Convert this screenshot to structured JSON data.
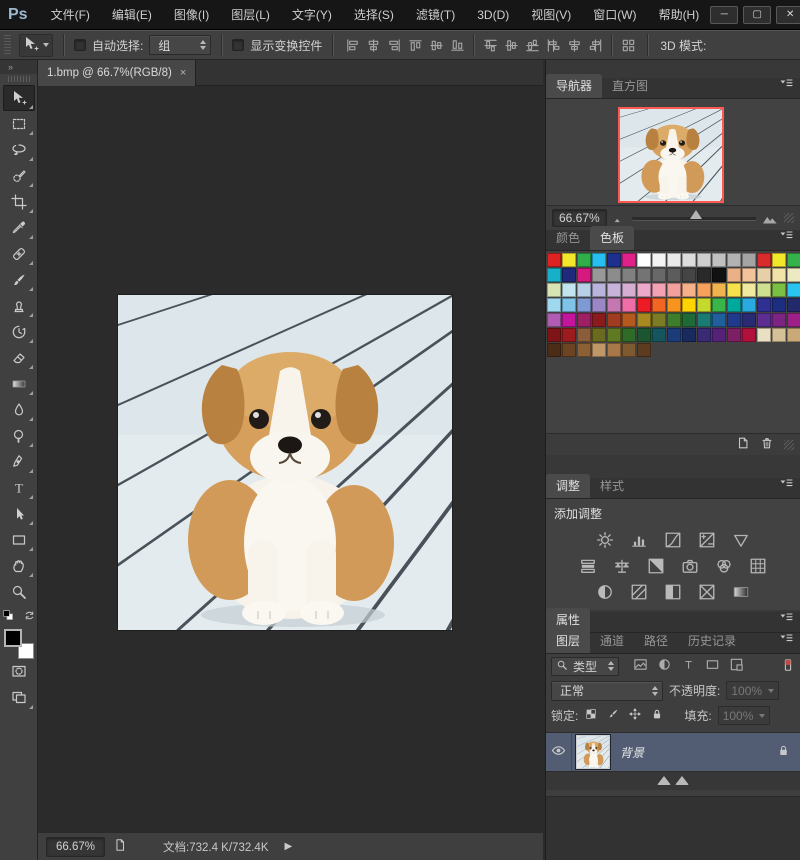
{
  "window": {
    "logo": "Ps",
    "controls": {
      "minimize": "─",
      "maximize": "▢",
      "close": "✕"
    }
  },
  "menu_bar": {
    "items": [
      "文件(F)",
      "编辑(E)",
      "图像(I)",
      "图层(L)",
      "文字(Y)",
      "选择(S)",
      "滤镜(T)",
      "3D(D)",
      "视图(V)",
      "窗口(W)",
      "帮助(H)"
    ]
  },
  "options_bar": {
    "active_tool_icon": "move-tool",
    "auto_select_label": "自动选择:",
    "auto_select_value": "组",
    "show_transform_label": "显示变换控件",
    "mode_3d_label": "3D 模式:",
    "align_groups": [
      [
        "align-left",
        "align-h-center",
        "align-right"
      ],
      [
        "align-top",
        "align-v-center",
        "align-bottom"
      ],
      [
        "dist-top",
        "dist-v-center",
        "dist-bottom"
      ],
      [
        "dist-left",
        "dist-h-center",
        "dist-right"
      ],
      [
        "auto-align"
      ]
    ]
  },
  "document_tab": {
    "title": "1.bmp @ 66.7%(RGB/8)",
    "close": "×"
  },
  "toolbar": {
    "collapse_chevrons": "»",
    "tools": [
      {
        "name": "move-tool",
        "selected": true,
        "flyout": true
      },
      {
        "name": "marquee-tool",
        "selected": false,
        "flyout": true
      },
      {
        "name": "lasso-tool",
        "selected": false,
        "flyout": true
      },
      {
        "name": "quick-select-tool",
        "selected": false,
        "flyout": true
      },
      {
        "name": "crop-tool",
        "selected": false,
        "flyout": true
      },
      {
        "name": "eyedropper-tool",
        "selected": false,
        "flyout": true
      },
      {
        "name": "healing-brush-tool",
        "selected": false,
        "flyout": true
      },
      {
        "name": "brush-tool",
        "selected": false,
        "flyout": true
      },
      {
        "name": "clone-stamp-tool",
        "selected": false,
        "flyout": true
      },
      {
        "name": "history-brush-tool",
        "selected": false,
        "flyout": true
      },
      {
        "name": "eraser-tool",
        "selected": false,
        "flyout": true
      },
      {
        "name": "gradient-tool",
        "selected": false,
        "flyout": true
      },
      {
        "name": "blur-tool",
        "selected": false,
        "flyout": true
      },
      {
        "name": "dodge-tool",
        "selected": false,
        "flyout": true
      },
      {
        "name": "pen-tool",
        "selected": false,
        "flyout": true
      },
      {
        "name": "type-tool",
        "selected": false,
        "flyout": true
      },
      {
        "name": "path-select-tool",
        "selected": false,
        "flyout": true
      },
      {
        "name": "rectangle-tool",
        "selected": false,
        "flyout": true
      },
      {
        "name": "hand-tool",
        "selected": false,
        "flyout": true
      },
      {
        "name": "zoom-tool",
        "selected": false,
        "flyout": false
      }
    ]
  },
  "panels": {
    "navigator": {
      "tabs": [
        {
          "label": "导航器",
          "active": true
        },
        {
          "label": "直方图",
          "active": false
        }
      ],
      "zoom": "66.67%"
    },
    "color": {
      "tabs": [
        {
          "label": "颜色",
          "active": false
        },
        {
          "label": "色板",
          "active": true
        }
      ],
      "swatch_rows": [
        [
          "#dd2222",
          "#f3e72c",
          "#2fae49",
          "#27bef0",
          "#1f2f8f",
          "#e0218a",
          "#ffffff",
          "#f4f4f4",
          "#e9e9e9",
          "#dcdcdc",
          "#cecece",
          "#c0c0c0",
          "#b2b2b2",
          "#a4a4a4",
          "#d92b2b",
          "#f3e72c",
          "#35b34a"
        ],
        [
          "#18b0c8",
          "#202a7c",
          "#d6197f",
          "#989898",
          "#8c8c8c",
          "#808080",
          "#747474",
          "#686868",
          "#5c5c5c",
          "#454545",
          "#2a2a2a",
          "#111111",
          "#eab188",
          "#f2c29a",
          "#e7cfa8",
          "#f2e3a8",
          "#ede9c2"
        ],
        [
          "#d9e4b5",
          "#c2e4ee",
          "#b8cfe8",
          "#b9b4dc",
          "#c7b3d9",
          "#d5aed1",
          "#eba8c8",
          "#f2a2b4",
          "#f2a09b",
          "#f5b18a",
          "#f6a25c",
          "#f0b44e",
          "#f5e14c",
          "#f0ea9e",
          "#cfe08e",
          "#7ac143",
          "#29c5f0"
        ],
        [
          "#9fd8ef",
          "#7fc3e8",
          "#7f9ad3",
          "#9b86c6",
          "#c577b2",
          "#ef6ea8",
          "#ed1c24",
          "#f26522",
          "#f7941d",
          "#ffd400",
          "#c5d92d",
          "#39b54a",
          "#00a99d",
          "#29abe2",
          "#2e3192",
          "#1c2e82",
          "#232a6b"
        ],
        [
          "#b05cb0",
          "#c4169c",
          "#9e1f63",
          "#8b1a1a",
          "#a23c20",
          "#b55a1f",
          "#a8891f",
          "#7c7c24",
          "#3e7d2c",
          "#1f6b38",
          "#1b7a74",
          "#1f5f9e",
          "#20398c",
          "#292a74",
          "#5d2d91",
          "#7b2482",
          "#9e1f87"
        ],
        [
          "#7e1416",
          "#9b1b1e",
          "#8a5d3b",
          "#6b6b1f",
          "#5f7a23",
          "#2e6b28",
          "#1c5631",
          "#15565e",
          "#1b3c78",
          "#182a5e",
          "#3a2a74",
          "#552277",
          "#7c1f63",
          "#b0103a",
          "#eadfc2",
          "#d6c097",
          "#c9a978"
        ],
        [
          "#4a2c17",
          "#6b4423",
          "#8a6034",
          "#c09868",
          "#a87848",
          "#7e5a30",
          "#5c3c1e"
        ]
      ]
    },
    "adjustments": {
      "tabs": [
        {
          "label": "调整",
          "active": true
        },
        {
          "label": "样式",
          "active": false
        }
      ],
      "add_label": "添加调整",
      "icon_rows": [
        [
          "brightness-contrast",
          "levels",
          "curves",
          "exposure",
          "vibrance"
        ],
        [
          "hue-saturation",
          "color-balance",
          "black-white",
          "photo-filter",
          "channel-mixer",
          "color-lookup"
        ],
        [
          "invert",
          "posterize",
          "threshold",
          "selective-color",
          "gradient-map"
        ]
      ]
    },
    "properties": {
      "tabs": [
        {
          "label": "属性",
          "active": true
        }
      ]
    },
    "layers": {
      "tabs": [
        {
          "label": "图层",
          "active": true
        },
        {
          "label": "通道",
          "active": false
        },
        {
          "label": "路径",
          "active": false
        },
        {
          "label": "历史记录",
          "active": false
        }
      ],
      "filter_type_label": "类型",
      "filter_icons": [
        "pixel-filter",
        "adjustment-filter",
        "type-filter",
        "shape-filter",
        "smartobject-filter"
      ],
      "blend_mode": "正常",
      "opacity_label": "不透明度:",
      "opacity_value": "100%",
      "lock_label": "锁定:",
      "lock_icons": [
        "lock-transparency",
        "lock-pixels",
        "lock-position",
        "lock-all"
      ],
      "fill_label": "填充:",
      "fill_value": "100%",
      "layer": {
        "name": "背景",
        "visible": true,
        "locked": true
      }
    },
    "swatch_bottombar_icons": [
      "new-swatch",
      "trash"
    ]
  },
  "status_bar": {
    "zoom": "66.67%",
    "doc_label": "文档:732.4 K/732.4K",
    "expand_arrow": "▶"
  },
  "colors": {
    "accent_view_box": "#ff5a52",
    "selected_layer_row": "#525d74",
    "panel_bg": "#424242",
    "canvas_bg": "#2b2b2b"
  }
}
